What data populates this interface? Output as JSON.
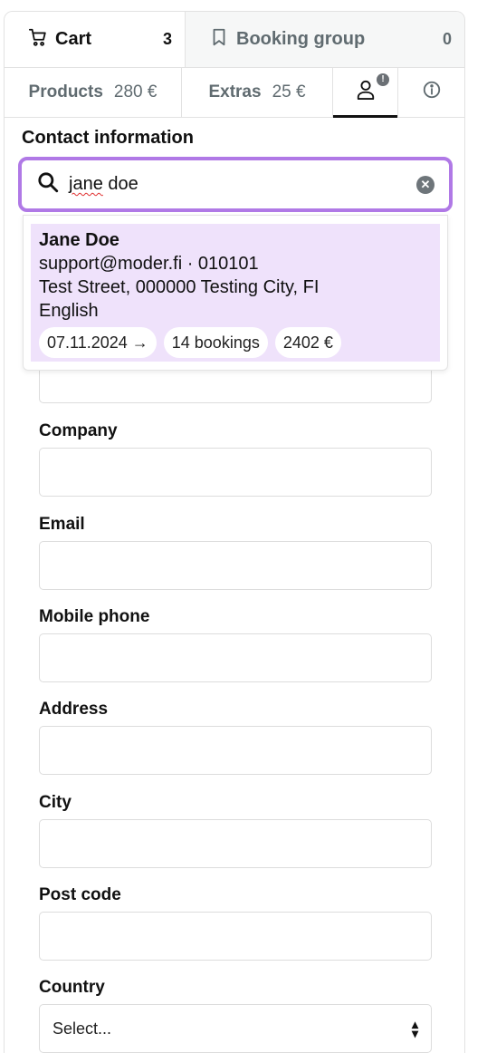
{
  "tabs": {
    "cart": {
      "label": "Cart",
      "count": "3",
      "icon": "cart-icon"
    },
    "booking_group": {
      "label": "Booking group",
      "count": "0",
      "icon": "bookmark-icon"
    }
  },
  "sub_tabs": {
    "products": {
      "label": "Products",
      "amount": "280 €"
    },
    "extras": {
      "label": "Extras",
      "amount": "25 €"
    },
    "contact": {
      "icon": "person-icon",
      "badge": "!"
    },
    "info": {
      "icon": "info-icon"
    }
  },
  "contact": {
    "title": "Contact information",
    "search": {
      "value": "jane doe",
      "typed_part": "jane",
      "rest": " doe"
    }
  },
  "result": {
    "name": "Jane Doe",
    "email_phone": "support@moder.fi · 010101",
    "address": "Test Street, 000000 Testing City, FI",
    "language": "English",
    "chips": [
      "07.11.2024 →",
      "14 bookings",
      "2402 €"
    ]
  },
  "form": {
    "company_label": "Company",
    "email_label": "Email",
    "mobile_label": "Mobile phone",
    "address_label": "Address",
    "city_label": "City",
    "postcode_label": "Post code",
    "country_label": "Country",
    "country_value": "Select..."
  },
  "colors": {
    "accent_border": "#b079e6",
    "result_bg": "#efe2fb",
    "muted_text": "#606b70"
  }
}
